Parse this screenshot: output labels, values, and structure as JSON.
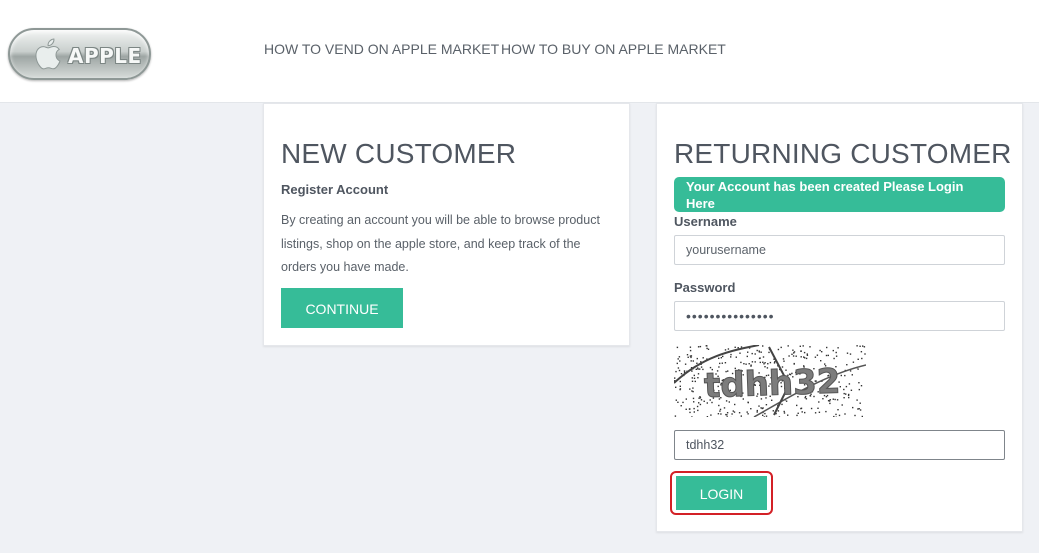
{
  "header": {
    "logo_text": "APPLE",
    "nav": [
      {
        "label": "HOW TO VEND ON APPLE MARKET"
      },
      {
        "label": "HOW TO BUY ON APPLE MARKET"
      }
    ]
  },
  "new_customer": {
    "title": "NEW CUSTOMER",
    "subtitle": "Register Account",
    "description": "By creating an account you will be able to browse product listings, shop on the apple store, and keep track of the orders you have made.",
    "continue_label": "CONTINUE"
  },
  "returning_customer": {
    "title": "RETURNING CUSTOMER",
    "alert": "Your Account has been created Please Login Here",
    "username_label": "Username",
    "username_value": "yourusername",
    "password_label": "Password",
    "password_value": "•••••••••••••••",
    "captcha_text": "tdhh32",
    "captcha_input_value": "tdhh32",
    "login_label": "LOGIN"
  },
  "colors": {
    "accent": "#36bc98",
    "highlight": "#d32026",
    "background": "#eff1f5"
  }
}
